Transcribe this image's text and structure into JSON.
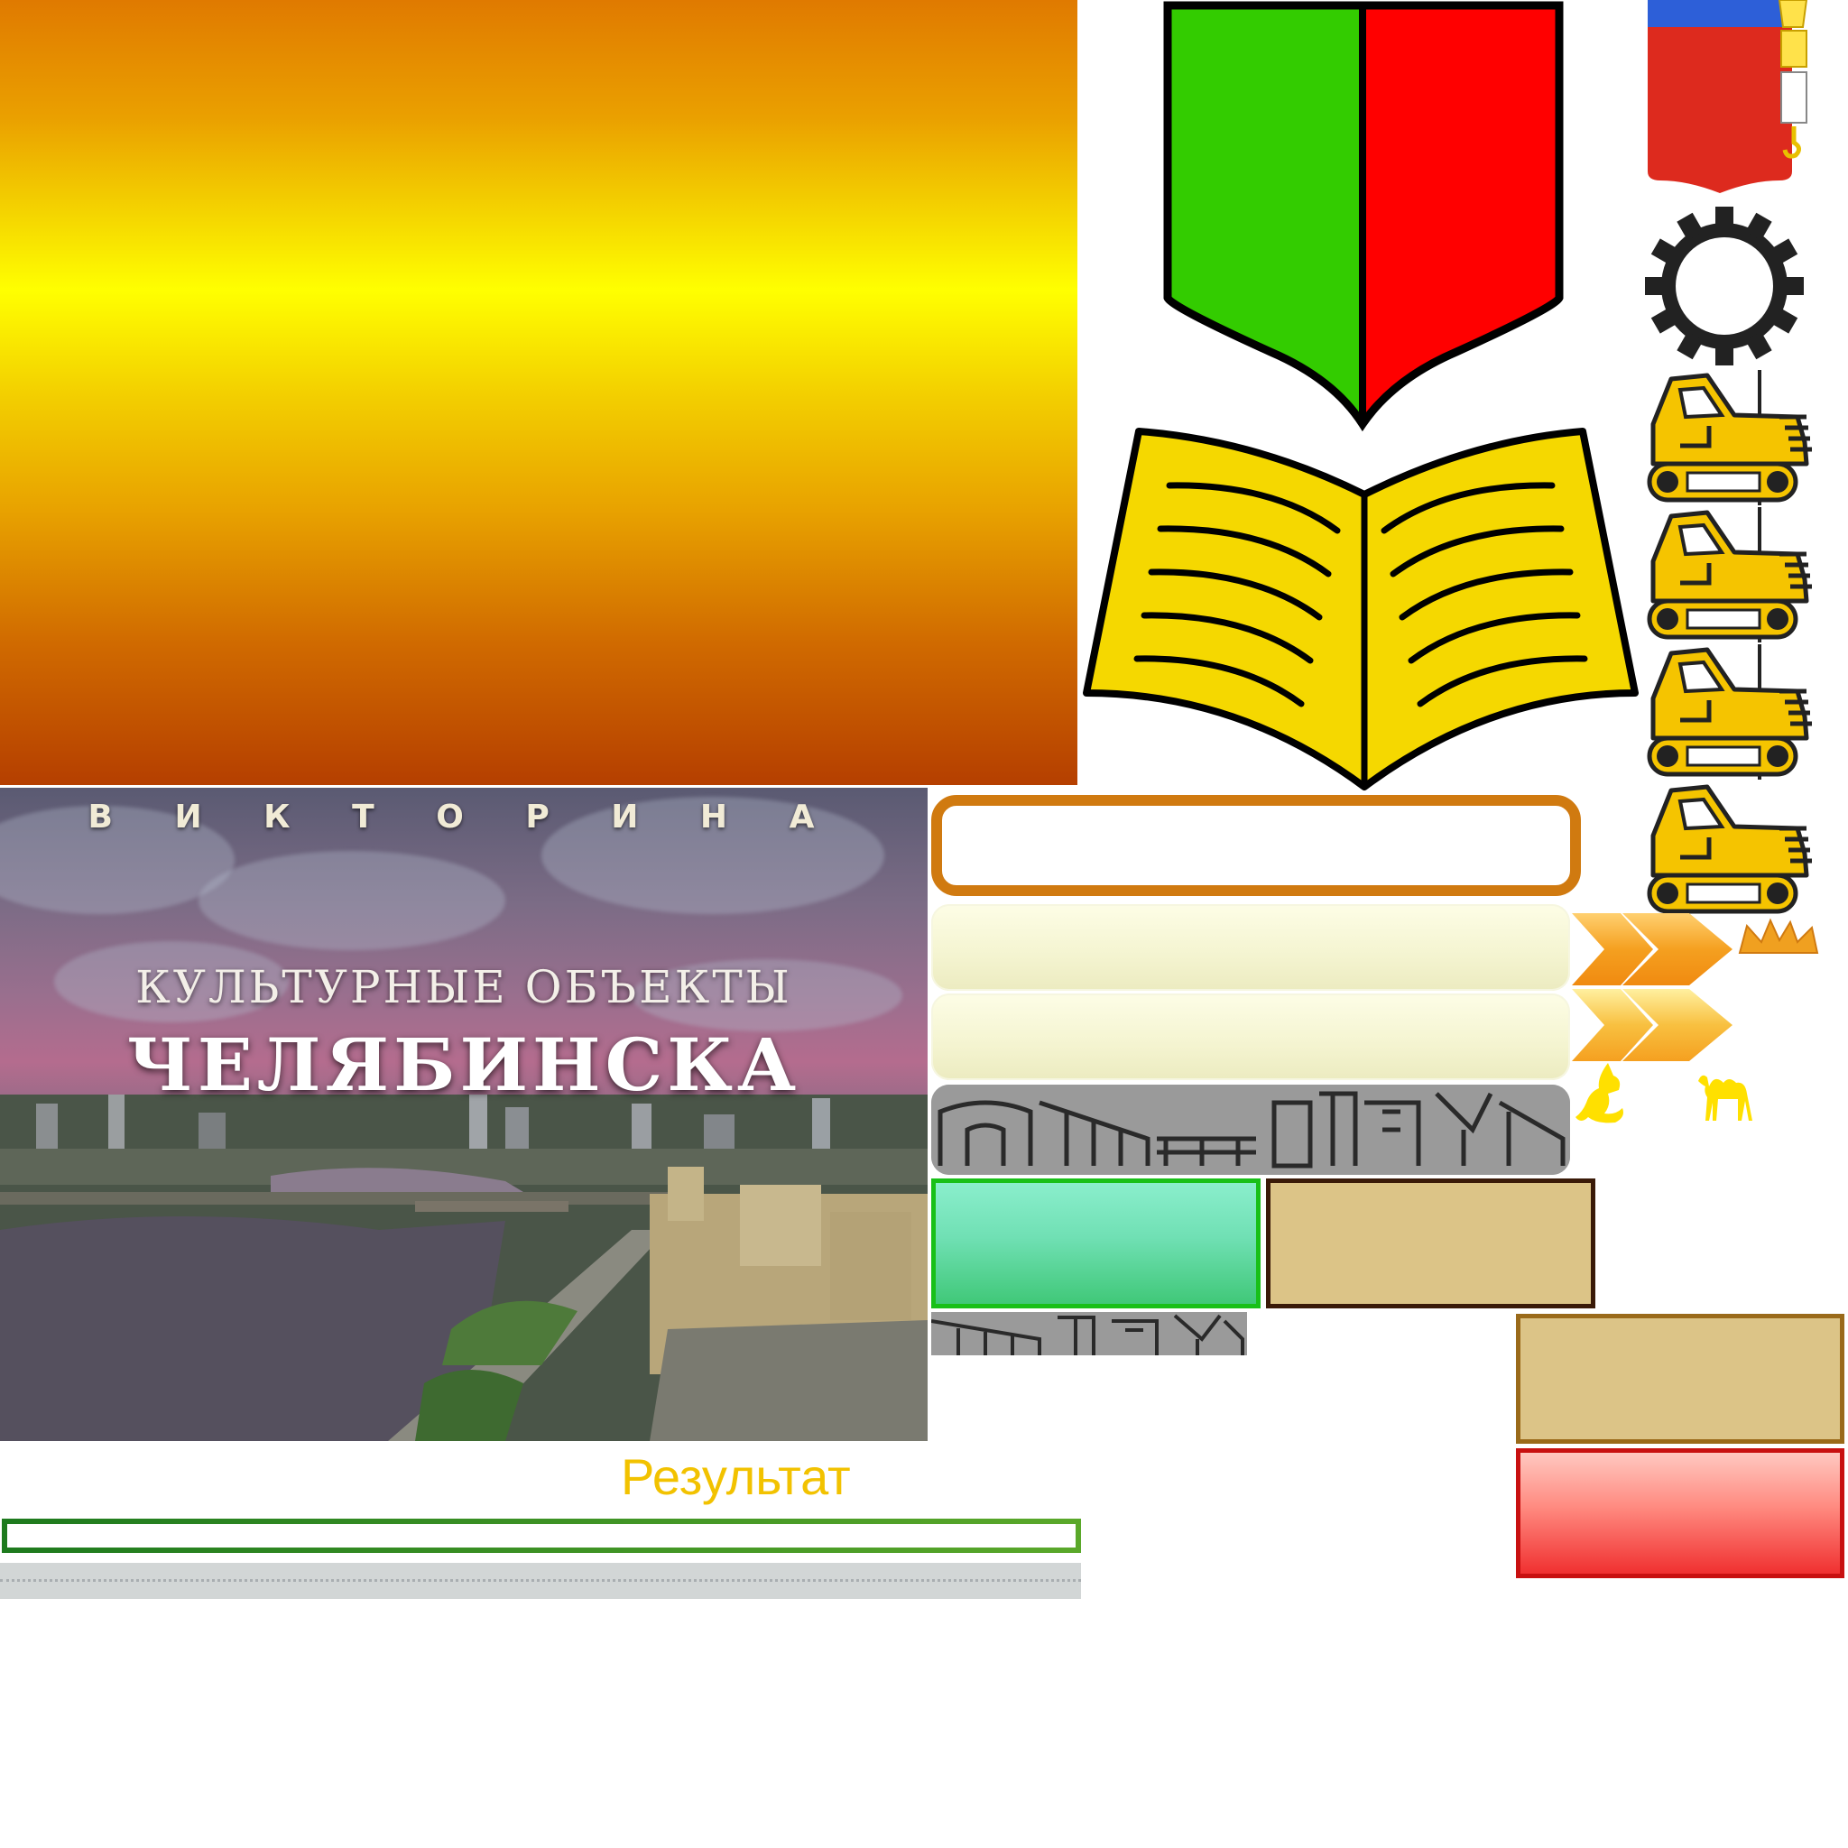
{
  "banner": {
    "kicker": "В И К Т О Р И Н А",
    "title_line1": "КУЛЬТУРНЫЕ ОБЪЕКТЫ",
    "title_line2": "ЧЕЛЯБИНСКА"
  },
  "result": {
    "label": "Результат"
  },
  "icons": [
    "shield-icon",
    "open-book-icon",
    "coat-of-arms-icon",
    "gear-icon",
    "bulldozer-icon",
    "chevron-arrows-icon",
    "crown-icon",
    "fox-icon",
    "camel-icon"
  ],
  "colors": {
    "accent_orange": "#d07a10",
    "gold_text": "#f2c200",
    "green_border": "#18c018",
    "red_border": "#c81010",
    "tan_fill": "#dcc487",
    "shield_green": "#33cc00",
    "shield_red": "#ff0000",
    "book_yellow": "#f5d800"
  }
}
